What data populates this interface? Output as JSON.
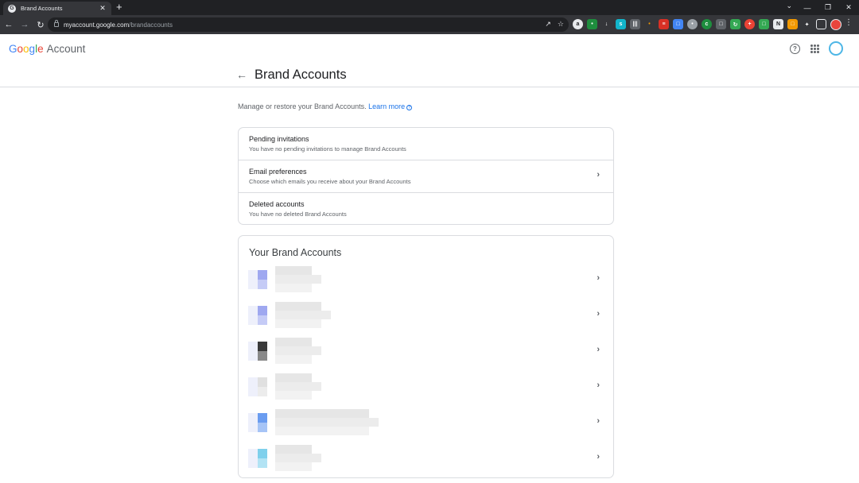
{
  "browser": {
    "tab_title": "Brand Accounts",
    "tab_favicon": "G",
    "tab_close": "✕",
    "new_tab": "+",
    "url_host": "myaccount.google.com",
    "url_path": "/brandaccounts"
  },
  "header": {
    "logo_letters": [
      "G",
      "o",
      "o",
      "g",
      "l",
      "e"
    ],
    "product": "Account"
  },
  "page": {
    "title": "Brand Accounts",
    "intro_text": "Manage or restore your Brand Accounts.",
    "learn_more": "Learn more",
    "info_glyph": "?"
  },
  "options": [
    {
      "title": "Pending invitations",
      "desc": "You have no pending invitations to manage Brand Accounts",
      "has_chevron": false
    },
    {
      "title": "Email preferences",
      "desc": "Choose which emails you receive about your Brand Accounts",
      "has_chevron": true
    },
    {
      "title": "Deleted accounts",
      "desc": "You have no deleted Brand Accounts",
      "has_chevron": false
    }
  ],
  "brand_accounts": {
    "heading": "Your Brand Accounts",
    "rows": [
      {
        "accent": "#9fa8f0",
        "note": "pixelated"
      },
      {
        "accent": "#9fa8f0",
        "note": "pixelated"
      },
      {
        "accent": "#3a3a3a",
        "note": "pixelated"
      },
      {
        "accent": "#e0e0e0",
        "note": "pixelated"
      },
      {
        "accent": "#6a9cf0",
        "note": "pixelated"
      },
      {
        "accent": "#7fd0ec",
        "note": "pixelated"
      }
    ]
  },
  "colors": {
    "link": "#1a73e8",
    "chrome_dark": "#202124",
    "divider": "#dadce0"
  }
}
